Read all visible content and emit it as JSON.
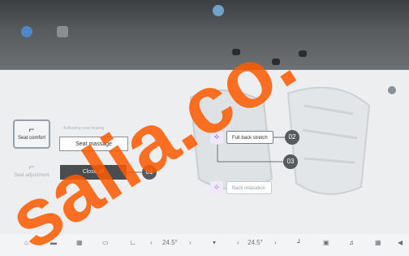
{
  "side_menu": {
    "seat_comfort": "Seat comfort",
    "seat_adjustment": "Seat adjustment"
  },
  "controls": {
    "header_text": "Activating seat heating",
    "seat_massage": "Seat massage",
    "close_all": "Close all"
  },
  "chips": {
    "full_back_stretch": "Full back stretch",
    "back_relaxation": "Back relaxation"
  },
  "callouts": {
    "c1": "01",
    "c2": "02",
    "c3": "03"
  },
  "bottom_bar": {
    "temp_left": "24.5°",
    "temp_right": "24.5°"
  },
  "watermark": {
    "text": "salia.co."
  },
  "colors": {
    "accent": "#ff5a00",
    "chip_icon": "#7a5cc8"
  }
}
